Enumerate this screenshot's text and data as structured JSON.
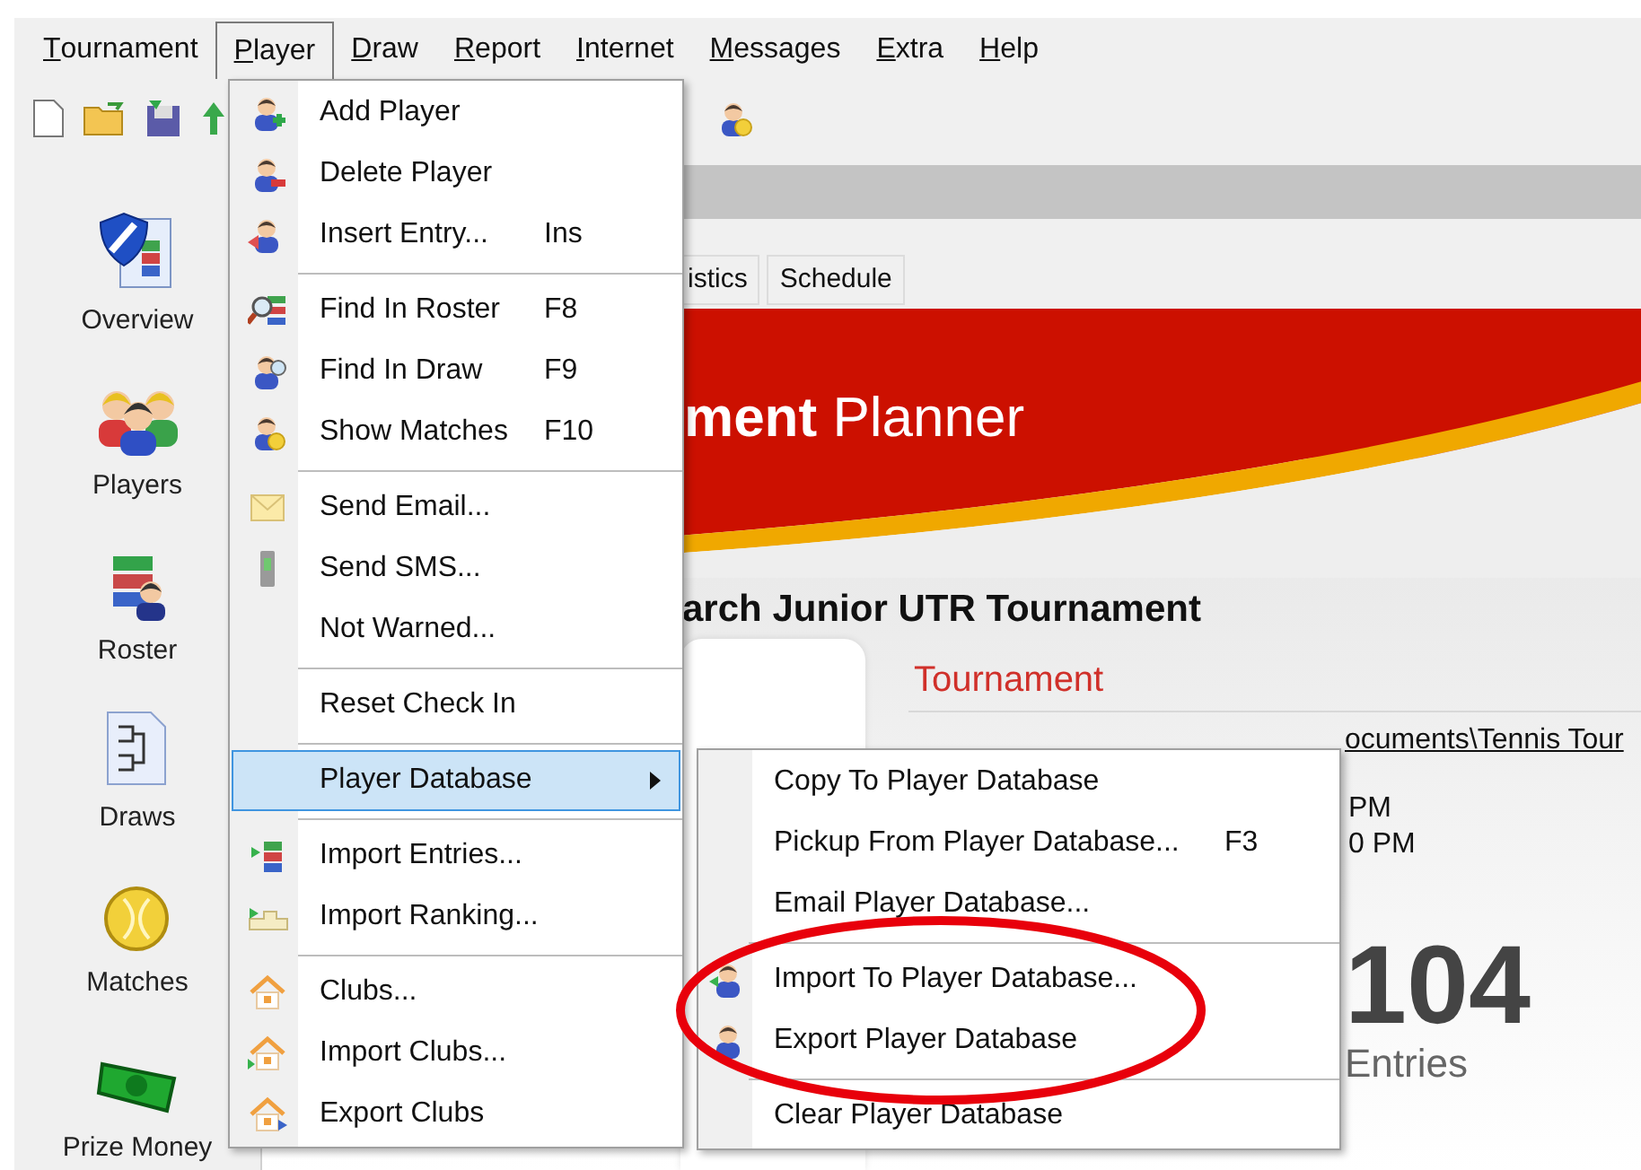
{
  "menubar": [
    {
      "label": "Tournament",
      "selected": false
    },
    {
      "label": "Player",
      "selected": true
    },
    {
      "label": "Draw",
      "selected": false
    },
    {
      "label": "Report",
      "selected": false
    },
    {
      "label": "Internet",
      "selected": false
    },
    {
      "label": "Messages",
      "selected": false
    },
    {
      "label": "Extra",
      "selected": false
    },
    {
      "label": "Help",
      "selected": false
    }
  ],
  "sidebar": {
    "items": [
      {
        "label": "Overview"
      },
      {
        "label": "Players"
      },
      {
        "label": "Roster"
      },
      {
        "label": "Draws"
      },
      {
        "label": "Matches"
      },
      {
        "label": "Prize Money"
      }
    ]
  },
  "tabs": [
    {
      "label": "istics"
    },
    {
      "label": "Schedule"
    }
  ],
  "banner": {
    "title_bold": "ment",
    "title": "Planner"
  },
  "tournament_name": "arch Junior UTR Tournament",
  "details": {
    "heading": "Tournament",
    "file": "ocuments\\Tennis Tour",
    "times": [
      "PM",
      "0 PM"
    ],
    "entries_count": "104",
    "entries_label": "Entries"
  },
  "player_menu": {
    "items": [
      {
        "kind": "item",
        "label": "Add Player",
        "selected": false
      },
      {
        "kind": "item",
        "label": "Delete Player",
        "selected": false
      },
      {
        "kind": "item",
        "label": "Insert Entry...",
        "shortcut": "Ins",
        "selected": false
      },
      {
        "kind": "separator"
      },
      {
        "kind": "item",
        "label": "Find In Roster",
        "shortcut": "F8",
        "selected": false
      },
      {
        "kind": "item",
        "label": "Find In Draw",
        "shortcut": "F9",
        "selected": false
      },
      {
        "kind": "item",
        "label": "Show Matches",
        "shortcut": "F10",
        "selected": false
      },
      {
        "kind": "separator"
      },
      {
        "kind": "item",
        "label": "Send Email...",
        "selected": false
      },
      {
        "kind": "item",
        "label": "Send SMS...",
        "selected": false
      },
      {
        "kind": "item",
        "label": "Not Warned...",
        "selected": false
      },
      {
        "kind": "separator"
      },
      {
        "kind": "item",
        "label": "Reset Check In",
        "selected": false
      },
      {
        "kind": "separator"
      },
      {
        "kind": "submenu",
        "label": "Player Database",
        "selected": true
      },
      {
        "kind": "separator"
      },
      {
        "kind": "item",
        "label": "Import Entries...",
        "selected": false
      },
      {
        "kind": "item",
        "label": "Import Ranking...",
        "selected": false
      },
      {
        "kind": "separator"
      },
      {
        "kind": "item",
        "label": "Clubs...",
        "selected": false
      },
      {
        "kind": "item",
        "label": "Import Clubs...",
        "selected": false
      },
      {
        "kind": "item",
        "label": "Export Clubs",
        "selected": false
      }
    ]
  },
  "submenu": {
    "items": [
      {
        "kind": "item",
        "label": "Copy To Player Database",
        "selected": false
      },
      {
        "kind": "item",
        "label": "Pickup From Player Database...",
        "shortcut": "F3",
        "selected": false
      },
      {
        "kind": "item",
        "label": "Email Player Database...",
        "selected": false
      },
      {
        "kind": "separator"
      },
      {
        "kind": "item",
        "label": "Import To Player Database...",
        "selected": false
      },
      {
        "kind": "item",
        "label": "Export Player Database",
        "selected": false
      },
      {
        "kind": "separator"
      },
      {
        "kind": "item",
        "label": "Clear Player Database",
        "selected": false
      }
    ]
  }
}
